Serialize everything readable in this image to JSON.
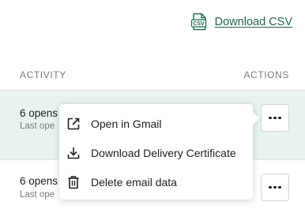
{
  "header": {
    "download_icon_text": "CSV",
    "download_label": "Download CSV"
  },
  "table": {
    "columns": {
      "activity": "ACTIVITY",
      "actions": "ACTIONS"
    },
    "rows": [
      {
        "title": "6 opens",
        "subtitle": "Last ope"
      },
      {
        "title": "6 opens",
        "subtitle": "Last ope"
      }
    ]
  },
  "menu": {
    "items": [
      {
        "label": "Open in Gmail",
        "icon": "external-link-icon"
      },
      {
        "label": "Download Delivery Certificate",
        "icon": "download-icon"
      },
      {
        "label": "Delete email data",
        "icon": "trash-icon"
      }
    ]
  },
  "colors": {
    "accent": "#1b6b4a",
    "selected_row": "#e8f3ef"
  }
}
